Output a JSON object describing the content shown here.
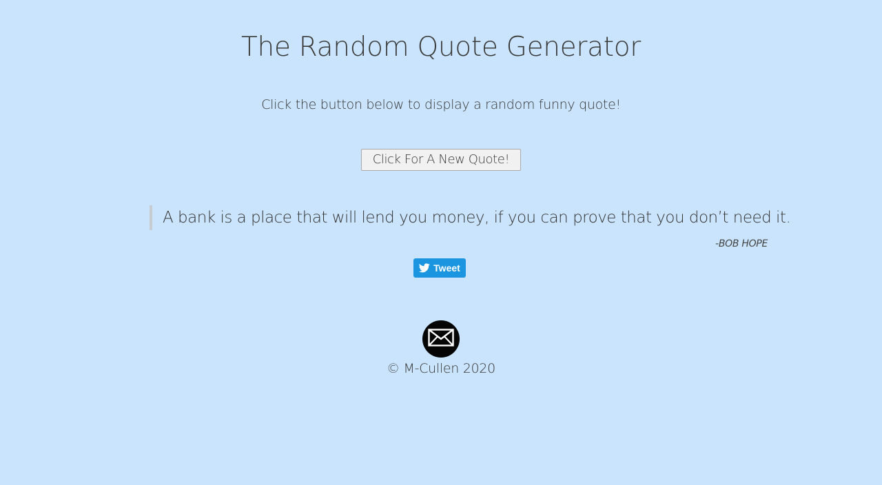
{
  "header": {
    "title": "The Random Quote Generator",
    "subtitle": "Click the button below to display a random funny quote!"
  },
  "controls": {
    "new_quote_label": "Click For A New Quote!"
  },
  "quote": {
    "text": "A bank is a place that will lend you money, if you can prove that you don’t need it.",
    "author": "-BOB HOPE"
  },
  "share": {
    "tweet_label": "Tweet",
    "icon": "twitter-bird-icon"
  },
  "footer": {
    "contact_icon": "envelope-icon",
    "copyright": "© M-Cullen 2020"
  },
  "colors": {
    "background": "#c9e4fc",
    "tweet_button": "#1b95e0",
    "text": "#333333"
  }
}
